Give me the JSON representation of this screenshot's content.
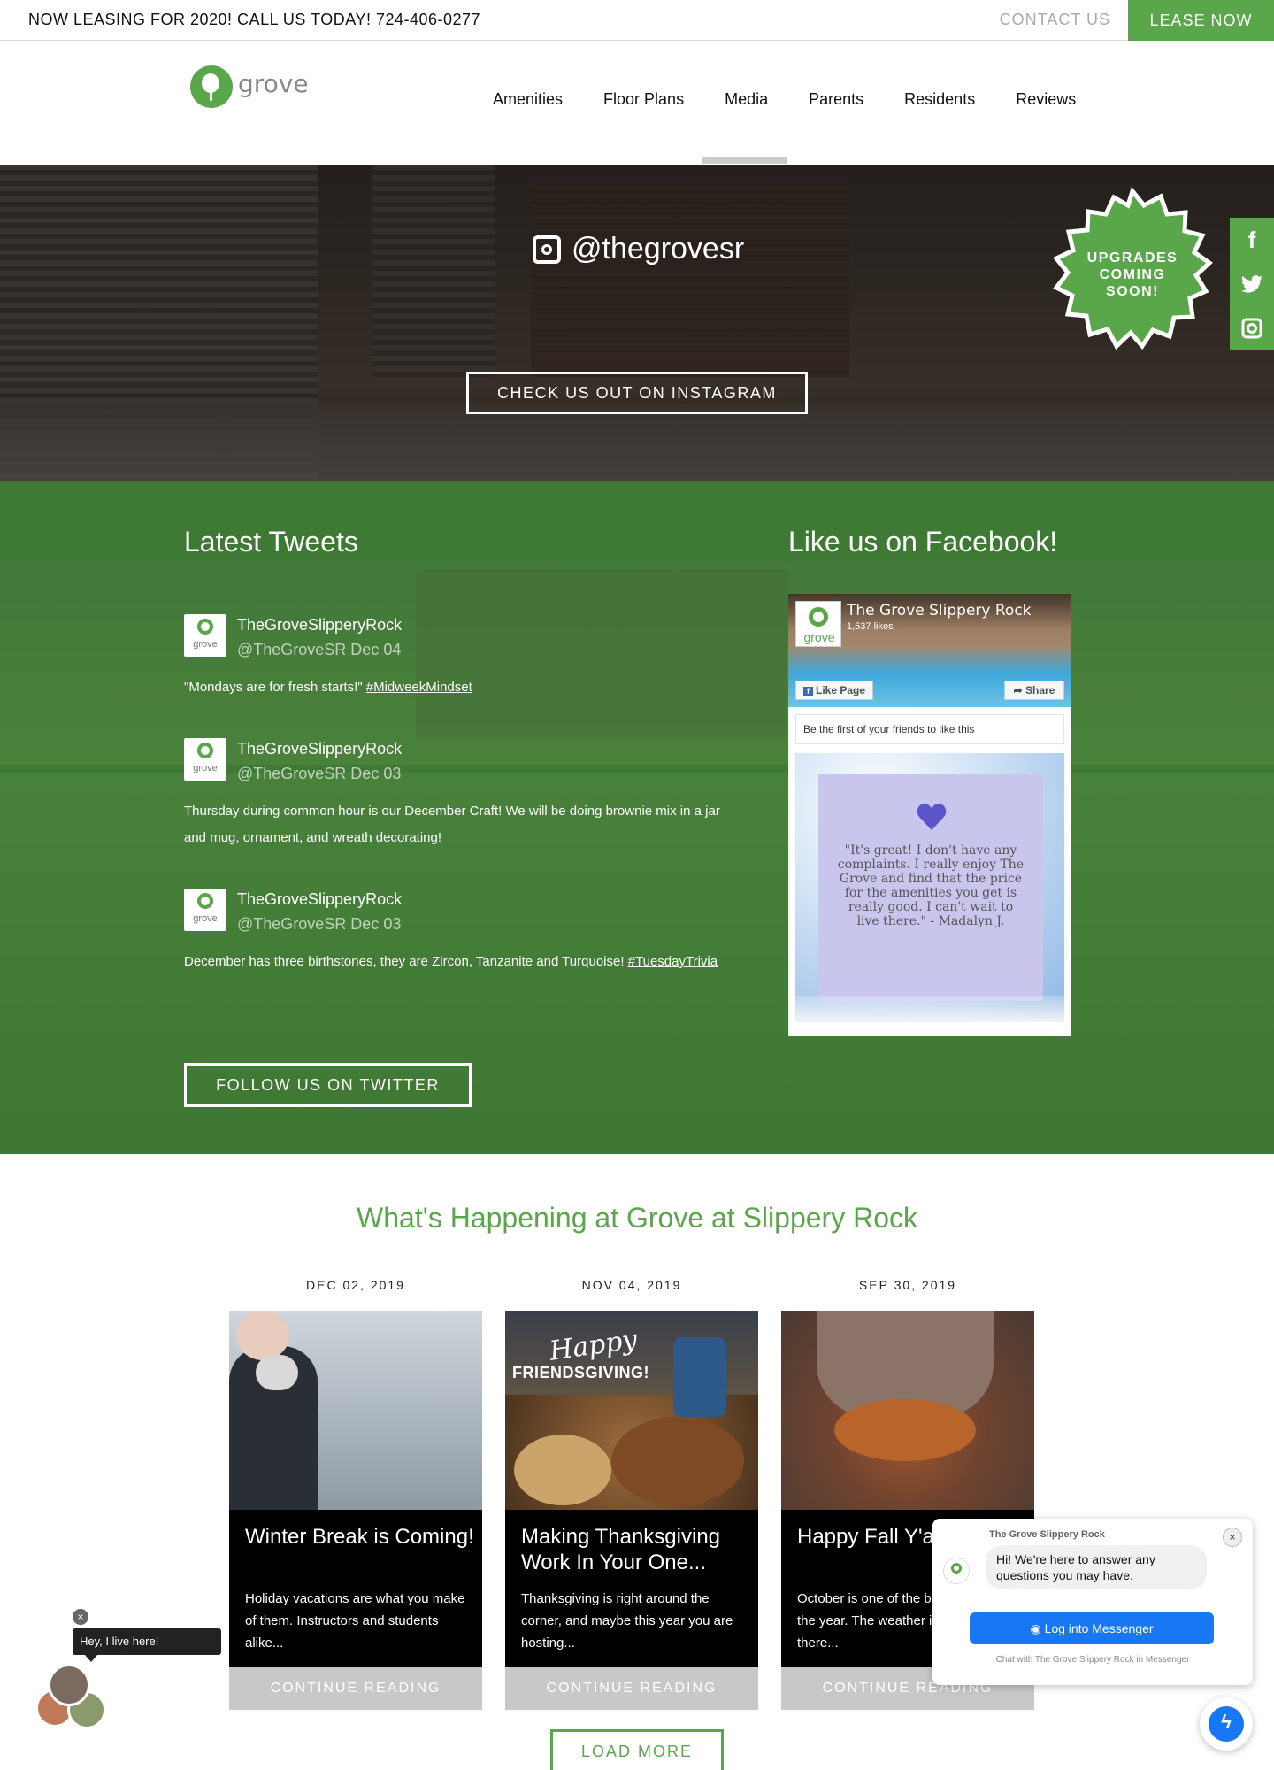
{
  "topbar": {
    "promo": "NOW LEASING FOR 2020! CALL US TODAY! 724-406-0277",
    "contact": "CONTACT US",
    "lease": "LEASE NOW"
  },
  "header": {
    "logo_text": "grove",
    "nav": [
      "Amenities",
      "Floor Plans",
      "Media",
      "Parents",
      "Residents",
      "Reviews"
    ],
    "active_nav": "Media"
  },
  "hero": {
    "handle": "@thegrovesr",
    "button": "CHECK US OUT ON INSTAGRAM",
    "badge": [
      "UPGRADES",
      "COMING",
      "SOON!"
    ],
    "social": [
      "facebook-icon",
      "twitter-icon",
      "instagram-icon"
    ]
  },
  "tweets": {
    "title": "Latest Tweets",
    "items": [
      {
        "name": "TheGroveSlipperyRock",
        "handle": "@TheGroveSR Dec 04",
        "text": "\"Mondays are for fresh starts!\" ",
        "tag": "#MidweekMindset"
      },
      {
        "name": "TheGroveSlipperyRock",
        "handle": "@TheGroveSR Dec 03",
        "text": "Thursday during common hour is our December Craft! We will be doing brownie mix in a jar and mug, ornament, and wreath decorating!",
        "tag": ""
      },
      {
        "name": "TheGroveSlipperyRock",
        "handle": "@TheGroveSR Dec 03",
        "text": "December has three birthstones, they are Zircon, Tanzanite and Turquoise! ",
        "tag": "#TuesdayTrivia"
      }
    ],
    "follow_button": "FOLLOW US ON TWITTER"
  },
  "facebook": {
    "title": "Like us on Facebook!",
    "page_name": "The Grove Slippery Rock",
    "likes": "1,537 likes",
    "like_button": "Like Page",
    "share_button": "Share",
    "friends_text": "Be the first of your friends to like this",
    "logo_text": "grove",
    "quote": "\"It's great! I don't have any complaints. I really enjoy The Grove and find that the price for the amenities you get is really good. I can't wait to live there.\" - Madalyn J."
  },
  "happening": {
    "title": "What's Happening at Grove at Slippery Rock",
    "posts": [
      {
        "date": "DEC 02, 2019",
        "title": "Winter Break is Coming!",
        "excerpt": "Holiday vacations are what you make of them. Instructors and students alike...",
        "more": "CONTINUE READING"
      },
      {
        "date": "NOV 04, 2019",
        "title": "Making Thanksgiving Work In Your One...",
        "excerpt": "Thanksgiving is right around the corner, and maybe this year you are hosting...",
        "more": "CONTINUE READING",
        "image_text": [
          "Happy",
          "FRIENDSGIVING!"
        ]
      },
      {
        "date": "SEP 30, 2019",
        "title": "Happy Fall Y'all",
        "excerpt": "October is one of the best times of the year. The weather is perfect and there...",
        "more": "CONTINUE READING"
      }
    ],
    "load_more": "LOAD MORE"
  },
  "chat": {
    "bubble": "Hey, I live here!",
    "close": "×"
  },
  "messenger": {
    "from": "The Grove Slippery Rock",
    "greeting": "Hi! We're here to answer any questions you may have.",
    "login": "Log into Messenger",
    "footer": "Chat with The Grove Slippery Rock in Messenger",
    "close": "×"
  },
  "colors": {
    "brand_green": "#5aa64a",
    "section_green": "#3f7a34",
    "messenger_blue": "#1877f2"
  }
}
